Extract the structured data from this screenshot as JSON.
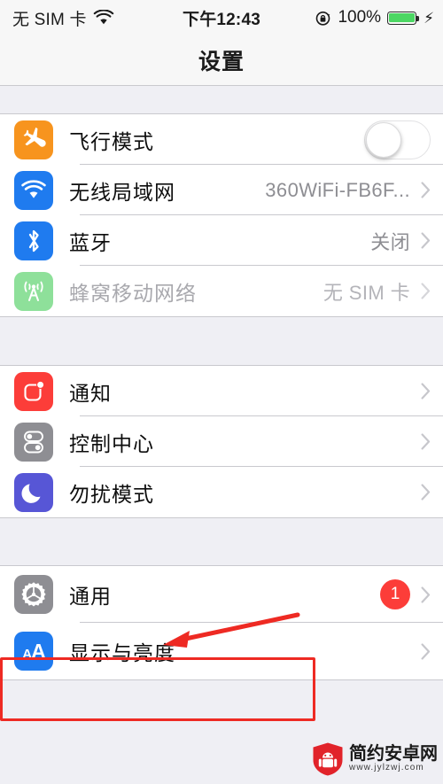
{
  "status_bar": {
    "carrier": "无 SIM 卡",
    "wifi_icon": "wifi-icon",
    "time": "下午12:43",
    "rotation_lock_icon": "rotation-lock-icon",
    "battery_percent": "100%",
    "battery_icon": "battery-full-icon",
    "charging_icon": "lightning-bolt-icon",
    "battery_color": "#4CD763"
  },
  "nav": {
    "title": "设置"
  },
  "groups": [
    {
      "rows": [
        {
          "label": "飞行模式",
          "icon": "airplane-icon",
          "icon_color": "#F7941E",
          "control": "toggle",
          "toggle_on": false
        },
        {
          "label": "无线局域网",
          "icon": "wifi-icon",
          "icon_color": "#1F7BEF",
          "value": "360WiFi-FB6F...",
          "control": "chevron"
        },
        {
          "label": "蓝牙",
          "icon": "bluetooth-icon",
          "icon_color": "#1F7BEF",
          "value": "关闭",
          "control": "chevron"
        },
        {
          "label": "蜂窝移动网络",
          "icon": "cellular-tower-icon",
          "icon_color": "#8EE09A",
          "value": "无 SIM 卡",
          "control": "chevron",
          "disabled": true
        }
      ]
    },
    {
      "rows": [
        {
          "label": "通知",
          "icon": "notifications-icon",
          "icon_color": "#FC3D39",
          "control": "chevron"
        },
        {
          "label": "控制中心",
          "icon": "control-center-icon",
          "icon_color": "#8E8E93",
          "control": "chevron"
        },
        {
          "label": "勿扰模式",
          "icon": "moon-icon",
          "icon_color": "#5756D6",
          "control": "chevron"
        }
      ]
    },
    {
      "rows": [
        {
          "label": "通用",
          "icon": "gear-icon",
          "icon_color": "#8E8E93",
          "badge": "1",
          "badge_color": "#FC3D39",
          "control": "chevron",
          "highlighted": true
        },
        {
          "label": "显示与亮度",
          "icon": "display-brightness-icon",
          "icon_color": "#1F7BEF",
          "control": "chevron"
        }
      ]
    }
  ],
  "annotation": {
    "highlight_color": "#EE2A23",
    "arrow_color": "#EE2A23",
    "target": "通用"
  },
  "watermark": {
    "name": "简约安卓网",
    "url": "www.jylzwj.com",
    "shield_color": "#E1232A"
  }
}
